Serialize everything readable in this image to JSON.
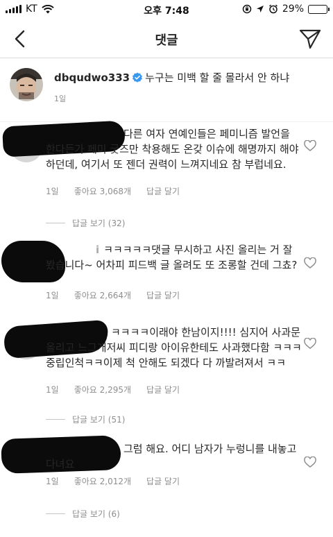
{
  "status_bar": {
    "carrier": "KT",
    "time": "오후 7:48",
    "battery_percent": "29%",
    "battery_level": 0.29
  },
  "nav": {
    "title": "댓글"
  },
  "caption": {
    "username": "dbqudwo333",
    "text": "누구는 미백 할 줄 몰라서 안 하냐",
    "time": "1일"
  },
  "comments": [
    {
      "username_visible": "",
      "text": "다른 여자 연예인들은 페미니즘 발언을 한다든가 페미 굿즈만 착용해도 온갖 이슈에 해명까지 해야하던데, 여기서 또 젠더 권력이 느껴지네요 참 부럽네요.",
      "time": "1일",
      "likes": "좋아요 3,068개",
      "reply": "답글 달기",
      "view_replies": "답글 보기 (32)"
    },
    {
      "username_visible": "i",
      "text": "ㅋㅋㅋㅋㅋ댓글 무시하고 사진 올리는 거 잘 봤습니다~ 어차피 피드백 글 올려도 또 조롱할 건데 그쵸?",
      "time": "1일",
      "likes": "좋아요 2,664개",
      "reply": "답글 달기",
      "view_replies": ""
    },
    {
      "username_visible": "",
      "text": "ㅋㅋㅋㅋ이래야 한남이지!!!! 심지어 사과문 올리고 느그개저씨 피디랑 아이유한테도 사과했다함 ㅋㅋㅋ 중립인척ㅋㅋ이제 척 안해도 되겠다 다 까발려져서 ㅋㅋ",
      "time": "1일",
      "likes": "좋아요 2,295개",
      "reply": "답글 달기",
      "view_replies": "답글 보기 (51)"
    },
    {
      "username_visible": "",
      "text": "그럼 해요. 어디 남자가 누렁니를 내놓고 다녀요",
      "time": "1일",
      "likes": "좋아요 2,012개",
      "reply": "답글 달기",
      "view_replies": "답글 보기 (6)"
    }
  ],
  "icons": {
    "back": "chevron-left-icon",
    "share": "paper-plane-icon",
    "like": "heart-outline-icon",
    "verified": "verified-badge-icon"
  },
  "colors": {
    "text": "#262626",
    "muted": "#8e8e8e",
    "verified": "#3897f0",
    "divider": "#dbdbdb"
  }
}
